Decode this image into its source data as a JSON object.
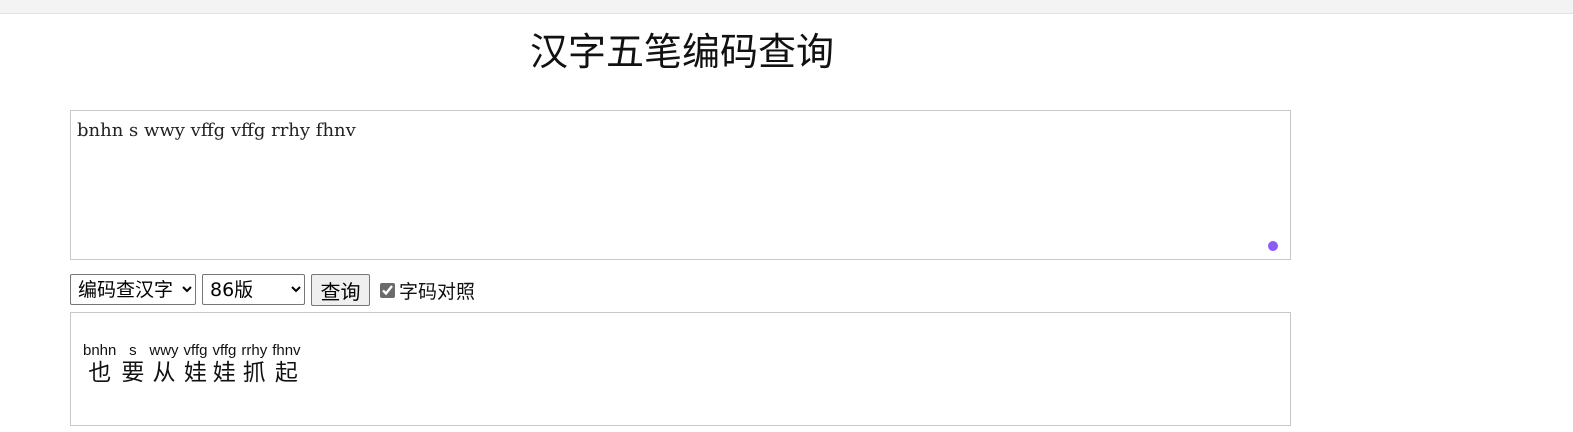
{
  "page": {
    "title": "汉字五笔编码查询"
  },
  "input": {
    "value": "bnhn s wwy vffg vffg rrhy fhnv"
  },
  "controls": {
    "mode_options": [
      "编码查汉字"
    ],
    "mode_selected": "编码查汉字",
    "version_options": [
      "86版"
    ],
    "version_selected": "86版",
    "query_label": "查询",
    "compare_label": "字码对照",
    "compare_checked": true
  },
  "result": {
    "pairs": [
      {
        "code": "bnhn",
        "char": "也"
      },
      {
        "code": "s",
        "char": "要"
      },
      {
        "code": "wwy",
        "char": "从"
      },
      {
        "code": "vffg",
        "char": "娃"
      },
      {
        "code": "vffg",
        "char": "娃"
      },
      {
        "code": "rrhy",
        "char": "抓"
      },
      {
        "code": "fhnv",
        "char": "起"
      }
    ]
  },
  "colors": {
    "resize_handle": "#8b5cf6"
  }
}
